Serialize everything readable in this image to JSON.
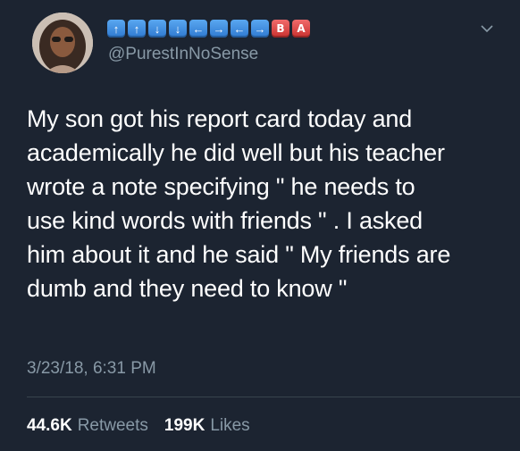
{
  "tweet": {
    "handle": "@PurestInNoSense",
    "name_keys": [
      {
        "type": "arrow",
        "symbol": "↑"
      },
      {
        "type": "arrow",
        "symbol": "↑"
      },
      {
        "type": "arrow",
        "symbol": "↓"
      },
      {
        "type": "arrow",
        "symbol": "↓"
      },
      {
        "type": "arrow",
        "symbol": "←"
      },
      {
        "type": "arrow",
        "symbol": "→"
      },
      {
        "type": "arrow",
        "symbol": "←"
      },
      {
        "type": "arrow",
        "symbol": "→"
      },
      {
        "type": "letter",
        "symbol": "B"
      },
      {
        "type": "letter",
        "symbol": "A"
      }
    ],
    "text_lines": [
      "My son got his report card today and",
      "academically he did well but his teacher",
      "wrote a note specifying \" he needs to",
      "use kind words with friends \" . I asked",
      "him about it and he said \" My friends are",
      "dumb and they need to know \""
    ],
    "timestamp": "3/23/18, 6:31 PM",
    "retweets_count": "44.6K",
    "retweets_label": "Retweets",
    "likes_count": "199K",
    "likes_label": "Likes"
  },
  "colors": {
    "background": "#1c2431",
    "muted_text": "#8899a6",
    "arrow_key": "#3f8ee0",
    "letter_key": "#d9403d"
  },
  "icons": {
    "menu": "chevron-down-icon"
  }
}
